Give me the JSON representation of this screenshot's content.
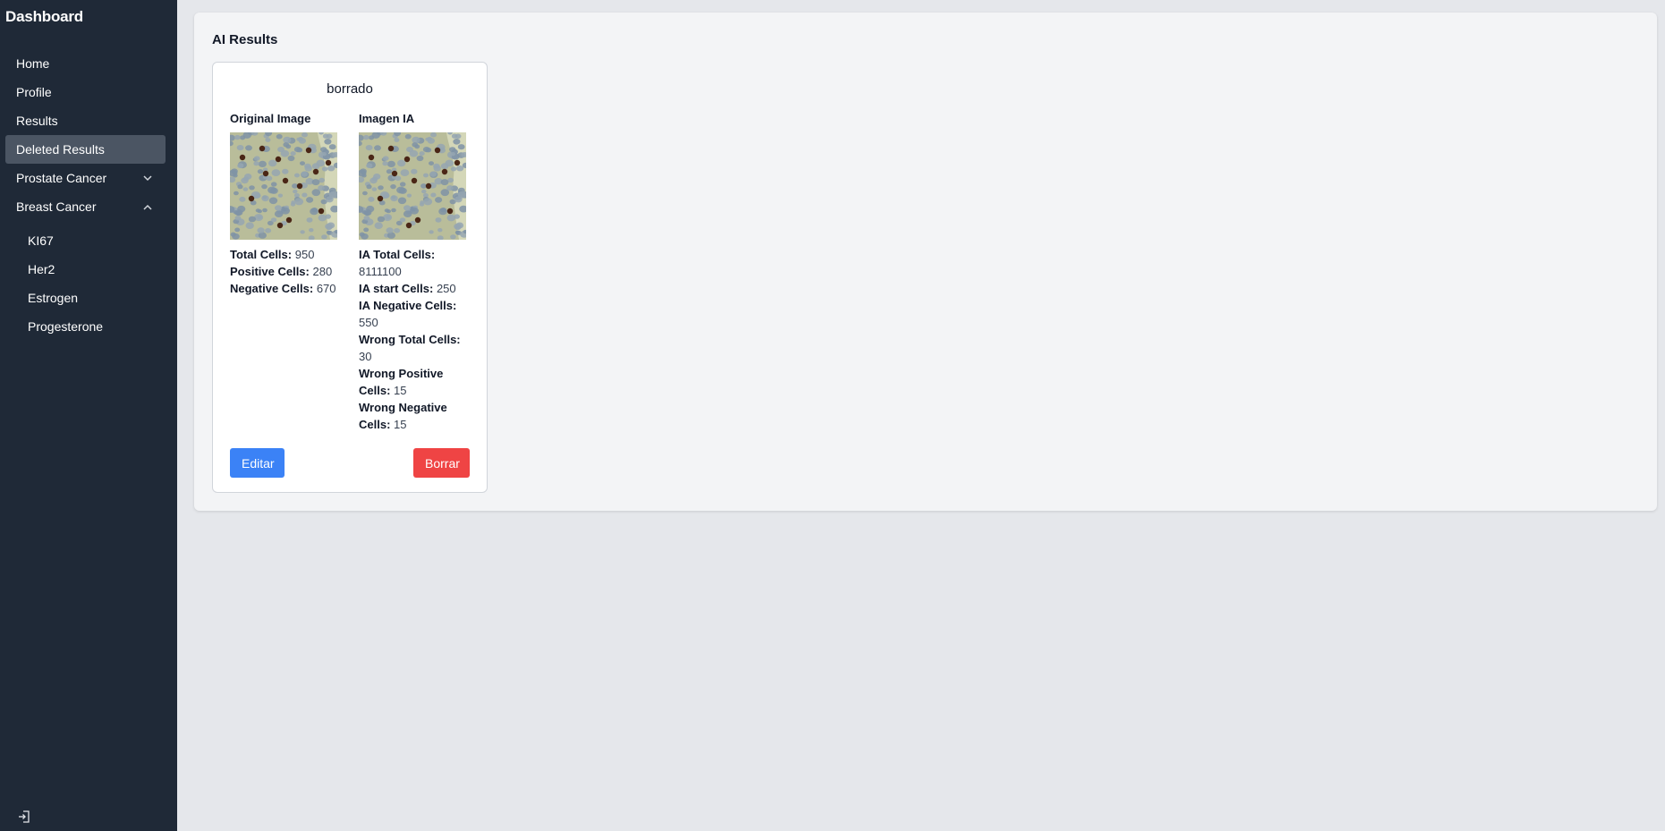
{
  "sidebar": {
    "brand": "Dashboard",
    "items": [
      {
        "label": "Home"
      },
      {
        "label": "Profile"
      },
      {
        "label": "Results"
      },
      {
        "label": "Deleted Results"
      },
      {
        "label": "Prostate Cancer"
      },
      {
        "label": "Breast Cancer"
      }
    ],
    "sub_items": [
      {
        "label": "KI67"
      },
      {
        "label": "Her2"
      },
      {
        "label": "Estrogen"
      },
      {
        "label": "Progesterone"
      }
    ],
    "active_item": "Deleted Results",
    "logout_icon": "logout-icon"
  },
  "main": {
    "title": "AI Results",
    "card": {
      "title": "borrado",
      "left": {
        "heading": "Original Image",
        "stats": [
          {
            "label": "Total Cells:",
            "value": "950"
          },
          {
            "label": "Positive Cells:",
            "value": "280"
          },
          {
            "label": "Negative Cells:",
            "value": "670"
          }
        ]
      },
      "right": {
        "heading": "Imagen IA",
        "stats": [
          {
            "label": "IA Total Cells:",
            "value": "8111100"
          },
          {
            "label": "IA start Cells:",
            "value": "250"
          },
          {
            "label": "IA Negative Cells:",
            "value": "550"
          },
          {
            "label": "Wrong Total Cells:",
            "value": "30"
          },
          {
            "label": "Wrong Positive Cells:",
            "value": "15"
          },
          {
            "label": "Wrong Negative Cells:",
            "value": "15"
          }
        ]
      },
      "edit_label": "Editar",
      "delete_label": "Borrar"
    }
  },
  "colors": {
    "sidebar_bg": "#1f2937",
    "active_bg": "#4b5563",
    "edit_button": "#3b82f6",
    "delete_button": "#ef4444"
  }
}
